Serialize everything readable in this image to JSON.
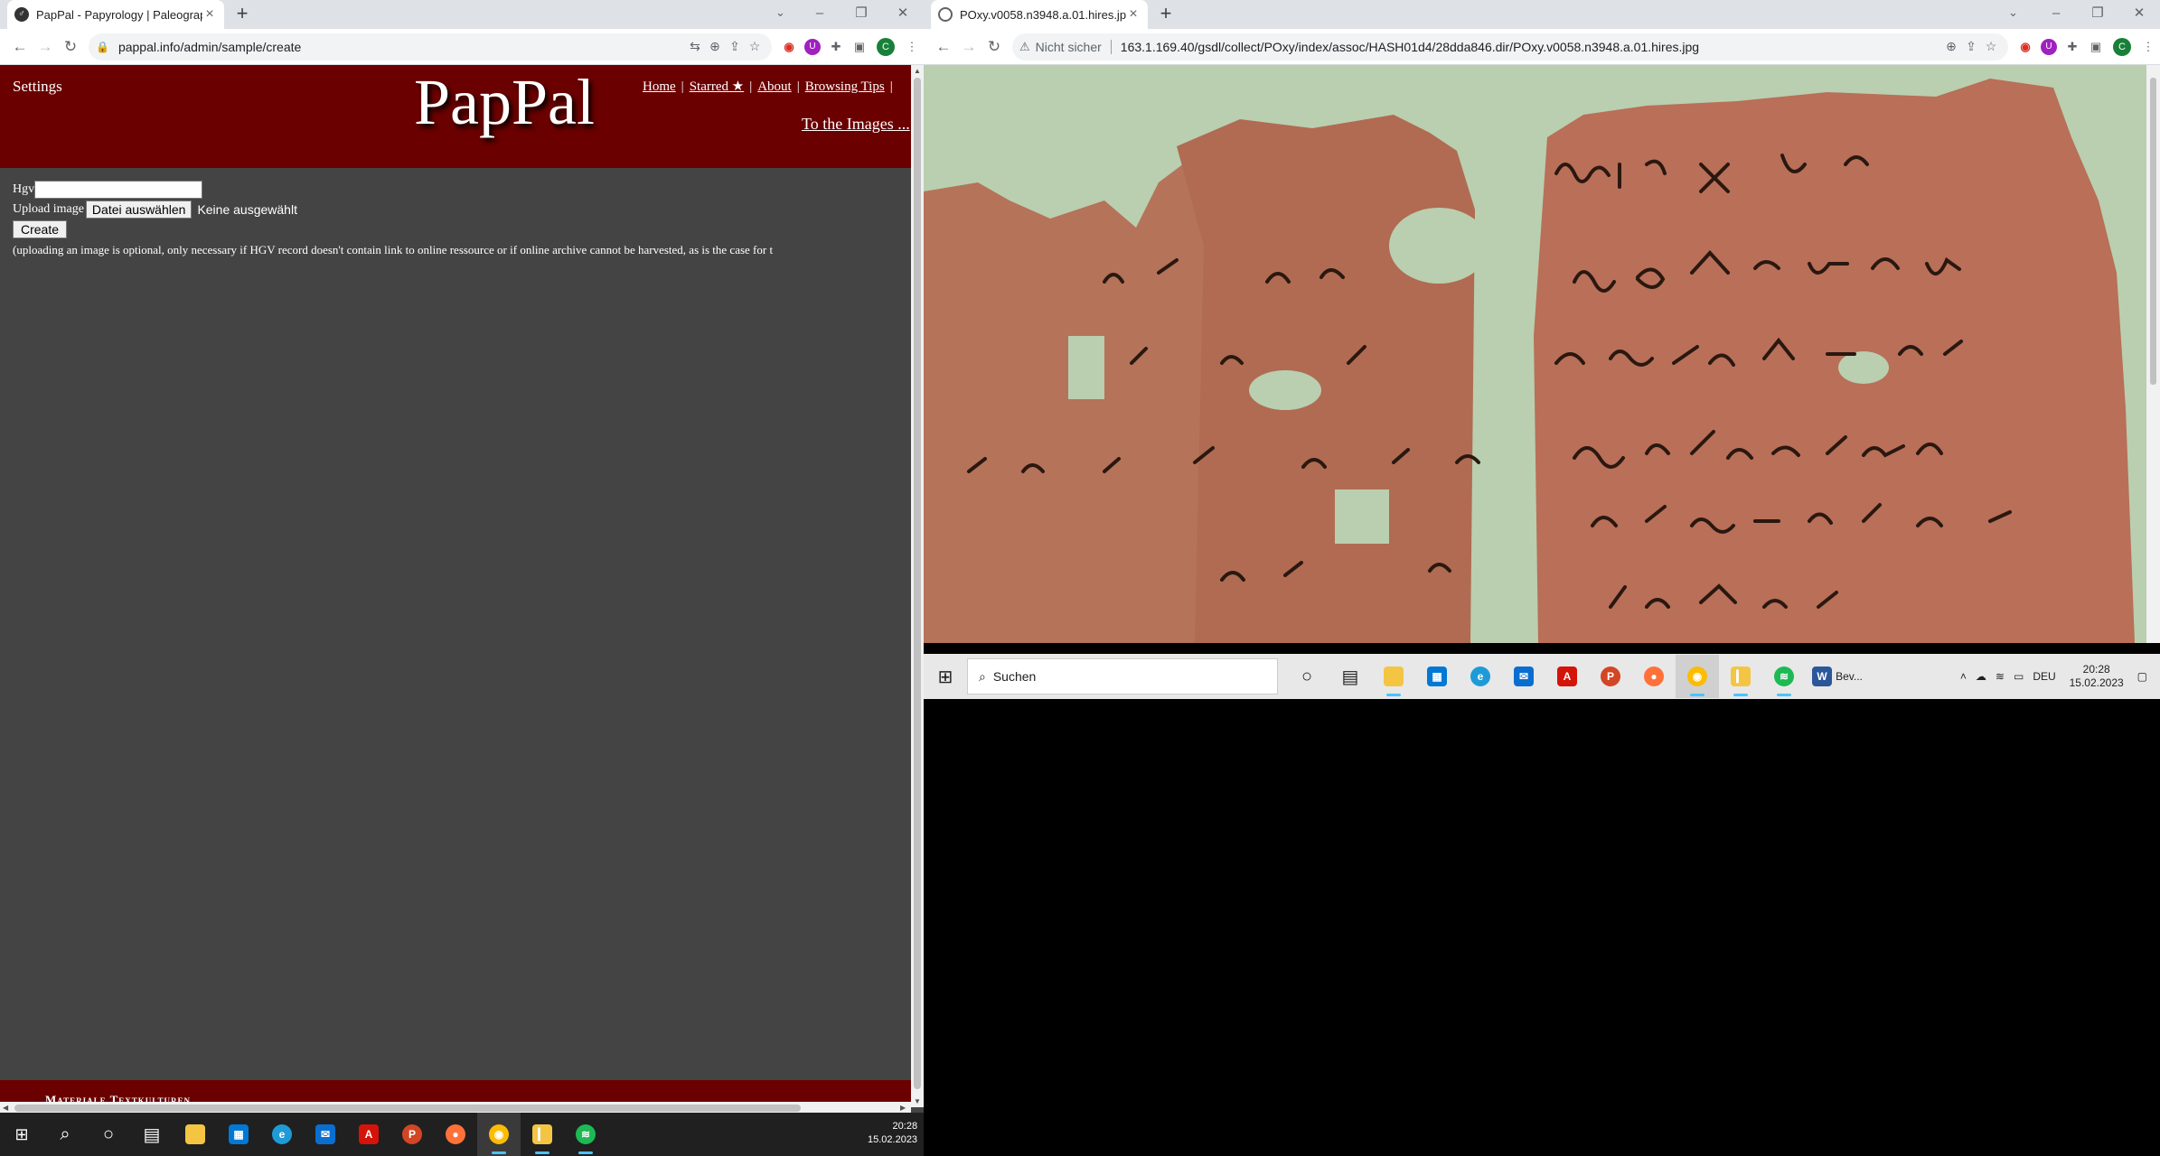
{
  "left_browser": {
    "tab_title": "PapPal - Papyrology | Paleograph",
    "tab_close": "×",
    "new_tab": "+",
    "url": "pappal.info/admin/sample/create"
  },
  "right_browser": {
    "tab_title": "POxy.v0058.n3948.a.01.hires.jpg",
    "tab_close": "×",
    "new_tab": "+",
    "security_label": "Nicht sicher",
    "url": "163.1.169.40/gsdl/collect/POxy/index/assoc/HASH01d4/28dda846.dir/POxy.v0058.n3948.a.01.hires.jpg"
  },
  "page": {
    "settings": "Settings",
    "logo": "PapPal",
    "nav": [
      "Home",
      "Starred ★",
      "About",
      "Browsing Tips"
    ],
    "nav_sep": "|",
    "to_images": "To the Images ...",
    "form": {
      "hgv_label": "Hgv",
      "upload_label": "Upload image",
      "file_button": "Datei auswählen",
      "no_file": "Keine ausgewählt",
      "create_button": "Create",
      "note": "(uploading an image is optional, only necessary if HGV record doesn't contain link to online ressource or if online archive cannot be harvested, as is the case for t"
    },
    "footer": "Materiale Textkulturen"
  },
  "taskbar_left": {
    "time": "20:28",
    "date": "15.02.2023"
  },
  "taskbar_right": {
    "search_placeholder": "Suchen",
    "word_label": "Bev...",
    "lang": "DEU",
    "time": "20:28",
    "date": "15.02.2023"
  },
  "colors": {
    "header_bg": "#6b0000",
    "page_bg": "#444444",
    "papyrus": "#b9745a",
    "background_green": "#b9cfb0"
  }
}
